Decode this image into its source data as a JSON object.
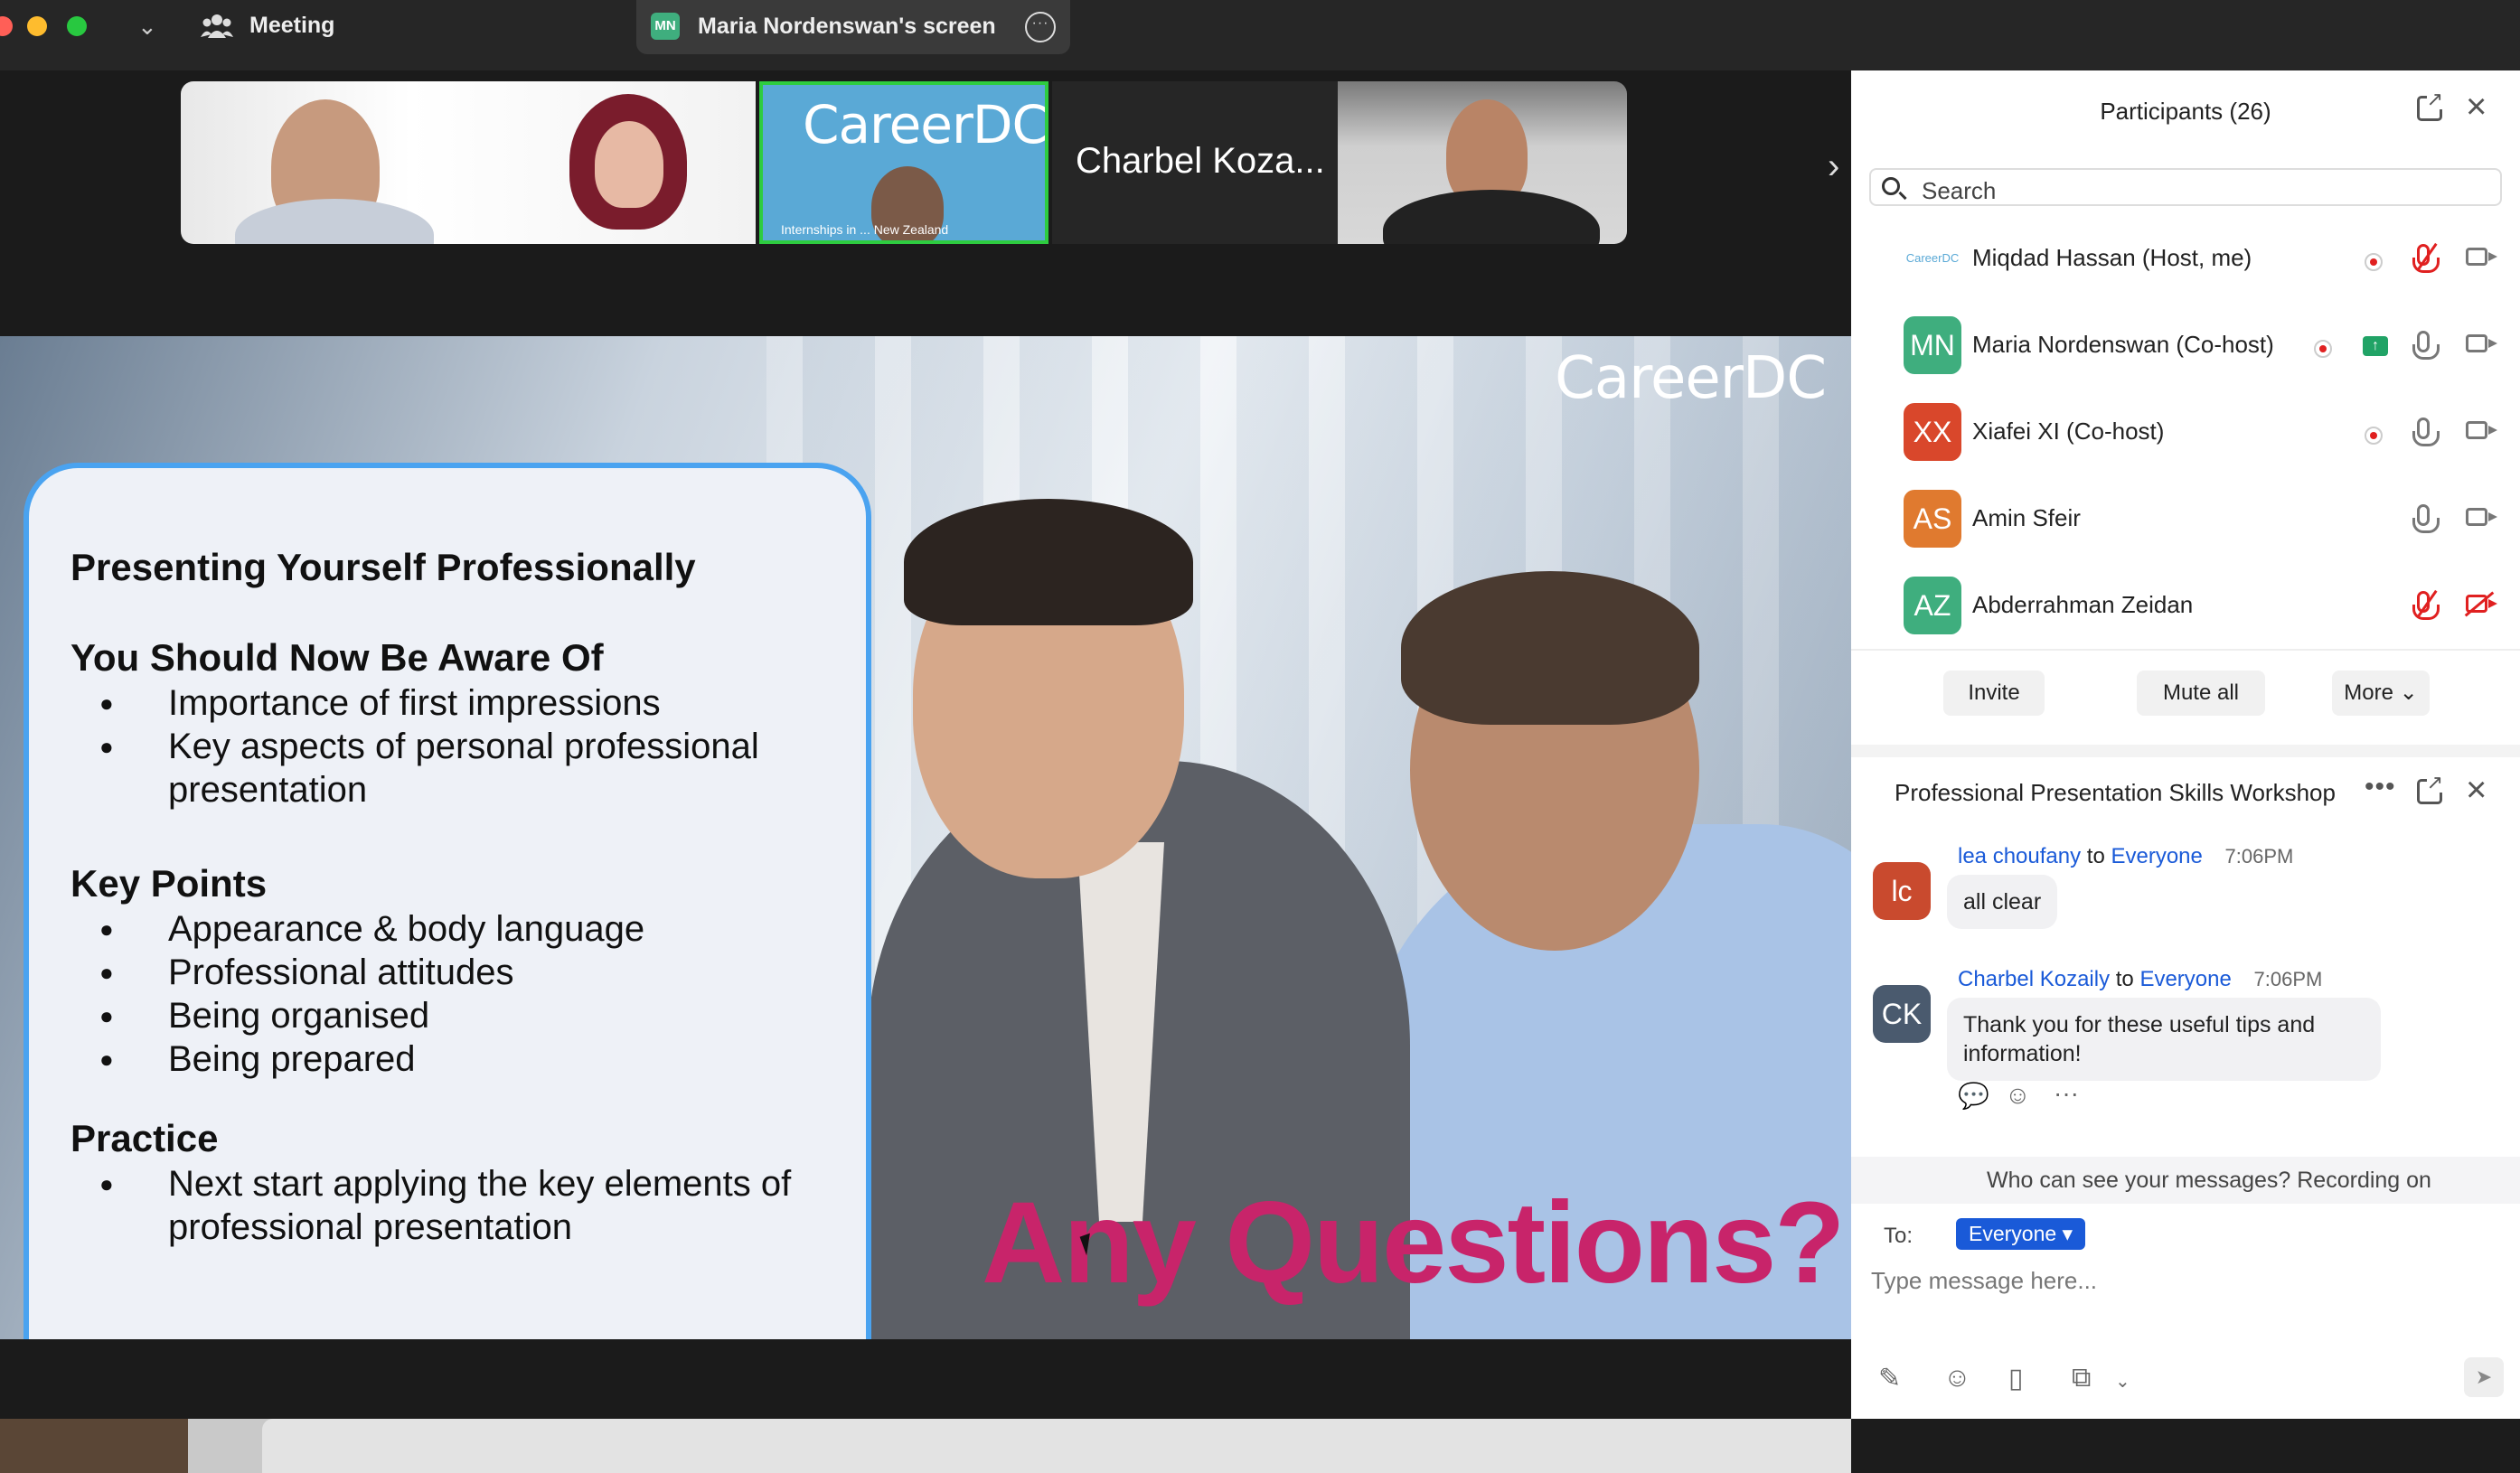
{
  "topbar": {
    "meeting_label": "Meeting",
    "share_initials": "MN",
    "share_label": "Maria Nordenswan's screen",
    "more_label": "···"
  },
  "thumbnails": {
    "t2_logo": "CareerDC",
    "t2_caption": "Internships in ... New Zealand",
    "t3_name": "Charbel Koza..."
  },
  "slide": {
    "brand": "CareerDC",
    "title": "Presenting Yourself Professionally",
    "section1": "You Should Now Be Aware Of",
    "section1_items": [
      "Importance of first impressions",
      "Key aspects of personal professional presentation"
    ],
    "section2": "Key  Points",
    "section2_items": [
      "Appearance & body language",
      "Professional attitudes",
      "Being organised",
      "Being prepared"
    ],
    "section3": "Practice",
    "section3_items": [
      "Next start applying the key elements of professional presentation"
    ],
    "overlay": "Any Questions?"
  },
  "participants": {
    "title": "Participants (26)",
    "search_placeholder": "Search",
    "list": [
      {
        "initials": "CareerDC",
        "name": "Miqdad Hassan (Host, me)",
        "color": "#ffffff"
      },
      {
        "initials": "MN",
        "name": "Maria Nordenswan (Co-host)",
        "color": "#3fae7e"
      },
      {
        "initials": "XX",
        "name": "Xiafei XI (Co-host)",
        "color": "#d9472b"
      },
      {
        "initials": "AS",
        "name": "Amin Sfeir",
        "color": "#e07a2f"
      },
      {
        "initials": "AZ",
        "name": "Abderrahman Zeidan",
        "color": "#3fae7e"
      }
    ],
    "buttons": {
      "invite": "Invite",
      "mute_all": "Mute all",
      "more": "More ⌄"
    }
  },
  "chat": {
    "title": "Professional Presentation Skills Workshop",
    "messages": [
      {
        "initials": "lc",
        "sender": "lea choufany",
        "to_word": "to",
        "to": "Everyone",
        "time": "7:06PM",
        "text": "all clear",
        "color": "#c94a2e"
      },
      {
        "initials": "CK",
        "sender": "Charbel Kozaily",
        "to_word": "to",
        "to": "Everyone",
        "time": "7:06PM",
        "text": "Thank you for these useful tips and information!",
        "color": "#4a5a6e"
      }
    ],
    "visibility": "Who can see your messages? Recording on",
    "to_label": "To:",
    "to_value": "Everyone ▾",
    "input_placeholder": "Type message here..."
  }
}
